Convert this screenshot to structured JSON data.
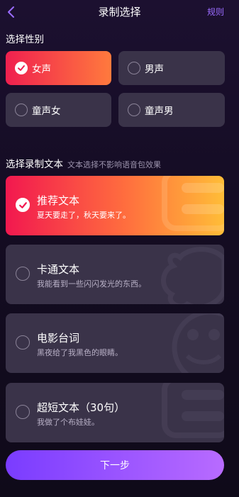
{
  "header": {
    "title": "录制选择",
    "rules_label": "规则",
    "back_icon": "chevron-left-icon"
  },
  "gender": {
    "title": "选择性别",
    "options": [
      {
        "label": "女声",
        "selected": true
      },
      {
        "label": "男声",
        "selected": false
      },
      {
        "label": "童声女",
        "selected": false
      },
      {
        "label": "童声男",
        "selected": false
      }
    ]
  },
  "text": {
    "title": "选择录制文本",
    "note": "文本选择不影响语音包效果",
    "cards": [
      {
        "title": "推荐文本",
        "subtitle": "夏天要走了，秋天要来了。",
        "selected": true
      },
      {
        "title": "卡通文本",
        "subtitle": "我能看到一些闪闪发光的东西。",
        "selected": false
      },
      {
        "title": "电影台词",
        "subtitle": "黑夜给了我黑色的眼睛。",
        "selected": false
      },
      {
        "title": "超短文本（30句）",
        "subtitle": "我做了个布娃娃。",
        "selected": false
      }
    ]
  },
  "footer": {
    "next_label": "下一步"
  },
  "colors": {
    "background": "#1c1030",
    "accent": "#9b6cff",
    "selected_gradient_start": "#f0204f",
    "selected_gradient_end": "#ff7a3d",
    "button_gradient_start": "#7a3cff",
    "button_gradient_end": "#b86bff",
    "card_bg": "#3a3349"
  }
}
